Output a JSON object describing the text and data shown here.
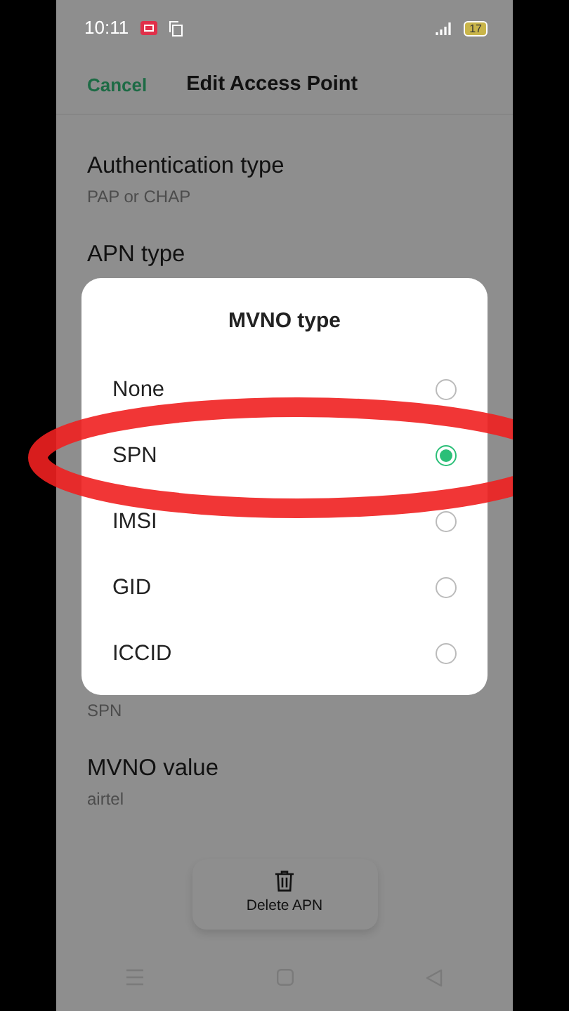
{
  "status_bar": {
    "time": "10:11",
    "battery": "17"
  },
  "header": {
    "cancel": "Cancel",
    "title": "Edit Access Point"
  },
  "settings_top": [
    {
      "label": "Authentication type",
      "value": "PAP or CHAP"
    },
    {
      "label": "APN type"
    }
  ],
  "settings_bottom": [
    {
      "value": "SPN"
    },
    {
      "label": "MVNO value",
      "value": "airtel"
    }
  ],
  "delete_button": "Delete APN",
  "dialog": {
    "title": "MVNO type",
    "options": [
      {
        "label": "None",
        "selected": false
      },
      {
        "label": "SPN",
        "selected": true
      },
      {
        "label": "IMSI",
        "selected": false
      },
      {
        "label": "GID",
        "selected": false
      },
      {
        "label": "ICCID",
        "selected": false
      }
    ]
  },
  "annotation": {
    "kind": "ellipse",
    "color": "#f02020"
  }
}
